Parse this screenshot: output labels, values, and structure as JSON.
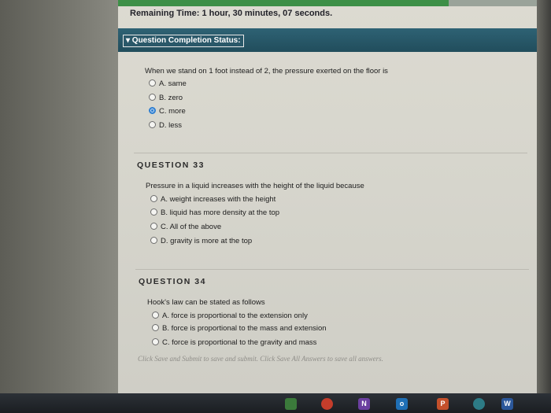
{
  "exam": {
    "remaining_time": "Remaining Time: 1 hour, 30 minutes, 07 seconds.",
    "status_toggle": "▾ Question Completion Status:"
  },
  "q32": {
    "text": "When we stand on 1 foot instead of 2, the pressure exerted on the floor is",
    "options": [
      {
        "label": "A. same",
        "selected": false
      },
      {
        "label": "B. zero",
        "selected": false
      },
      {
        "label": "C. more",
        "selected": true
      },
      {
        "label": "D. less",
        "selected": false
      }
    ]
  },
  "q33": {
    "title": "QUESTION 33",
    "text": "Pressure in a liquid increases with the height of the liquid because",
    "options": [
      {
        "label": "A. weight increases with the height",
        "selected": false
      },
      {
        "label": "B. liquid has more density at the top",
        "selected": false
      },
      {
        "label": "C. All of the above",
        "selected": false
      },
      {
        "label": "D. gravity is more at the top",
        "selected": false
      }
    ]
  },
  "q34": {
    "title": "QUESTION 34",
    "text": "Hook's law can be stated as follows",
    "options": [
      {
        "label": "A. force is proportional to the extension only",
        "selected": false
      },
      {
        "label": "B. force is proportional to the mass and extension",
        "selected": false
      },
      {
        "label": "C. force is proportional to the gravity and mass",
        "selected": false
      }
    ]
  },
  "footer": {
    "note": "Click Save and Submit to save and submit. Click Save All Answers to save all answers."
  },
  "taskbar": {
    "icons": [
      "N",
      "o",
      "P",
      "W"
    ]
  },
  "colors": {
    "progress": "#3d8f47",
    "status_bar": "#2e6274",
    "selected_radio": "#2f7fd1"
  }
}
